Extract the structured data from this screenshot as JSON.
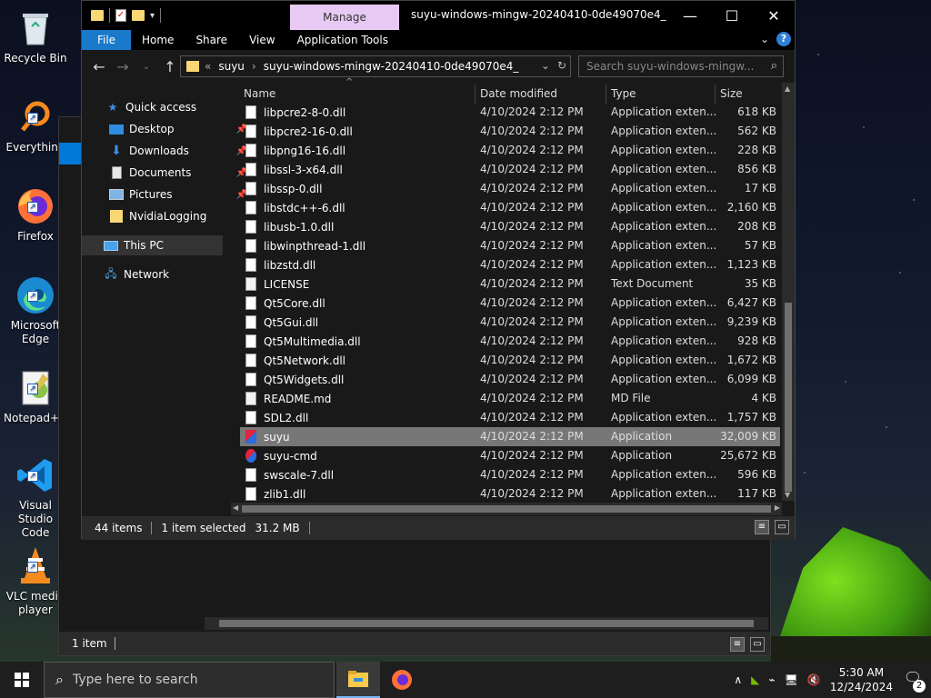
{
  "desktop": {
    "icons": [
      {
        "label": "Recycle Bin",
        "icon": "recycle-bin-icon"
      },
      {
        "label": "Everything",
        "icon": "everything-icon"
      },
      {
        "label": "Firefox",
        "icon": "firefox-icon"
      },
      {
        "label": "Microsoft Edge",
        "icon": "edge-icon"
      },
      {
        "label": "Notepad++",
        "icon": "notepadpp-icon"
      },
      {
        "label": "Visual Studio Code",
        "icon": "vscode-icon"
      },
      {
        "label": "VLC media player",
        "icon": "vlc-icon"
      }
    ]
  },
  "back_window": {
    "status": "1 item"
  },
  "window": {
    "title": "suyu-windows-mingw-20240410-0de49070e4_",
    "manage_tab": "Manage",
    "ribbon_tabs": [
      "File",
      "Home",
      "Share",
      "View",
      "Application Tools"
    ],
    "address": {
      "prefix": "«",
      "crumbs": [
        "suyu",
        "suyu-windows-mingw-20240410-0de49070e4_"
      ]
    },
    "search_placeholder": "Search suyu-windows-mingw...",
    "nav_pane": [
      {
        "label": "Quick access",
        "icon": "star-icon",
        "pinned": false
      },
      {
        "label": "Desktop",
        "icon": "desktop-icon",
        "pinned": true
      },
      {
        "label": "Downloads",
        "icon": "download-icon",
        "pinned": true
      },
      {
        "label": "Documents",
        "icon": "documents-icon",
        "pinned": true
      },
      {
        "label": "Pictures",
        "icon": "pictures-icon",
        "pinned": true
      },
      {
        "label": "NvidiaLogging",
        "icon": "folder-icon",
        "pinned": false
      },
      {
        "label": "This PC",
        "icon": "pc-icon",
        "pinned": false
      },
      {
        "label": "Network",
        "icon": "network-icon",
        "pinned": false
      }
    ],
    "columns": {
      "name": "Name",
      "date": "Date modified",
      "type": "Type",
      "size": "Size"
    },
    "files": [
      {
        "name": "libpcre2-8-0.dll",
        "date": "4/10/2024 2:12 PM",
        "type": "Application exten...",
        "size": "618 KB",
        "icon": "dll"
      },
      {
        "name": "libpcre2-16-0.dll",
        "date": "4/10/2024 2:12 PM",
        "type": "Application exten...",
        "size": "562 KB",
        "icon": "dll"
      },
      {
        "name": "libpng16-16.dll",
        "date": "4/10/2024 2:12 PM",
        "type": "Application exten...",
        "size": "228 KB",
        "icon": "dll"
      },
      {
        "name": "libssl-3-x64.dll",
        "date": "4/10/2024 2:12 PM",
        "type": "Application exten...",
        "size": "856 KB",
        "icon": "dll"
      },
      {
        "name": "libssp-0.dll",
        "date": "4/10/2024 2:12 PM",
        "type": "Application exten...",
        "size": "17 KB",
        "icon": "dll"
      },
      {
        "name": "libstdc++-6.dll",
        "date": "4/10/2024 2:12 PM",
        "type": "Application exten...",
        "size": "2,160 KB",
        "icon": "dll"
      },
      {
        "name": "libusb-1.0.dll",
        "date": "4/10/2024 2:12 PM",
        "type": "Application exten...",
        "size": "208 KB",
        "icon": "dll"
      },
      {
        "name": "libwinpthread-1.dll",
        "date": "4/10/2024 2:12 PM",
        "type": "Application exten...",
        "size": "57 KB",
        "icon": "dll"
      },
      {
        "name": "libzstd.dll",
        "date": "4/10/2024 2:12 PM",
        "type": "Application exten...",
        "size": "1,123 KB",
        "icon": "dll"
      },
      {
        "name": "LICENSE",
        "date": "4/10/2024 2:12 PM",
        "type": "Text Document",
        "size": "35 KB",
        "icon": "txt"
      },
      {
        "name": "Qt5Core.dll",
        "date": "4/10/2024 2:12 PM",
        "type": "Application exten...",
        "size": "6,427 KB",
        "icon": "dll"
      },
      {
        "name": "Qt5Gui.dll",
        "date": "4/10/2024 2:12 PM",
        "type": "Application exten...",
        "size": "9,239 KB",
        "icon": "dll"
      },
      {
        "name": "Qt5Multimedia.dll",
        "date": "4/10/2024 2:12 PM",
        "type": "Application exten...",
        "size": "928 KB",
        "icon": "dll"
      },
      {
        "name": "Qt5Network.dll",
        "date": "4/10/2024 2:12 PM",
        "type": "Application exten...",
        "size": "1,672 KB",
        "icon": "dll"
      },
      {
        "name": "Qt5Widgets.dll",
        "date": "4/10/2024 2:12 PM",
        "type": "Application exten...",
        "size": "6,099 KB",
        "icon": "dll"
      },
      {
        "name": "README.md",
        "date": "4/10/2024 2:12 PM",
        "type": "MD File",
        "size": "4 KB",
        "icon": "txt"
      },
      {
        "name": "SDL2.dll",
        "date": "4/10/2024 2:12 PM",
        "type": "Application exten...",
        "size": "1,757 KB",
        "icon": "dll"
      },
      {
        "name": "suyu",
        "date": "4/10/2024 2:12 PM",
        "type": "Application",
        "size": "32,009 KB",
        "icon": "app-suyu",
        "selected": true
      },
      {
        "name": "suyu-cmd",
        "date": "4/10/2024 2:12 PM",
        "type": "Application",
        "size": "25,672 KB",
        "icon": "app-cmd"
      },
      {
        "name": "swscale-7.dll",
        "date": "4/10/2024 2:12 PM",
        "type": "Application exten...",
        "size": "596 KB",
        "icon": "dll"
      },
      {
        "name": "zlib1.dll",
        "date": "4/10/2024 2:12 PM",
        "type": "Application exten...",
        "size": "117 KB",
        "icon": "dll"
      }
    ],
    "status": {
      "count": "44 items",
      "selected": "1 item selected",
      "size": "31.2 MB"
    }
  },
  "taskbar": {
    "search_placeholder": "Type here to search",
    "time": "5:30 AM",
    "date": "12/24/2024",
    "notification_count": "2"
  }
}
